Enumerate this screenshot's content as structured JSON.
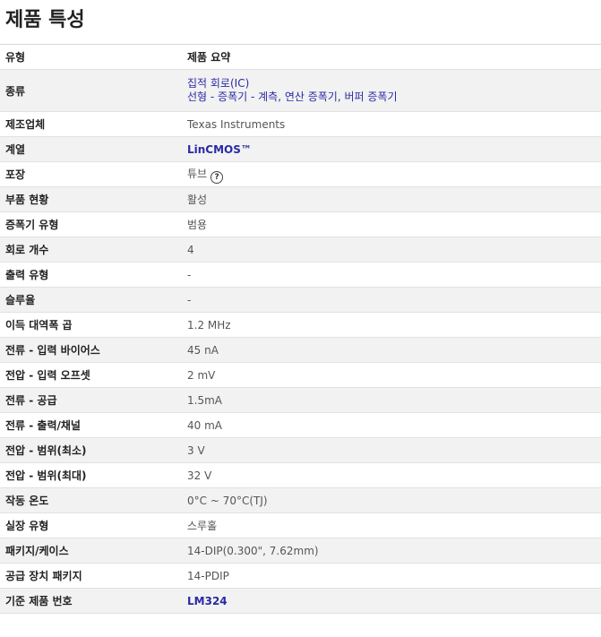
{
  "title": "제품 특성",
  "header": {
    "label": "유형",
    "value": "제품 요약"
  },
  "category": {
    "label": "종류",
    "line1": "집적 회로(IC)",
    "line2": "선형 - 증폭기 - 계측, 연산 증폭기, 버퍼 증폭기"
  },
  "rows": [
    {
      "label": "제조업체",
      "value": "Texas Instruments"
    },
    {
      "label": "계열",
      "value": "LinCMOS™"
    },
    {
      "label": "포장",
      "value": "튜브",
      "icon": "help-circle-icon"
    },
    {
      "label": "부품 현황",
      "value": "활성"
    },
    {
      "label": "증폭기 유형",
      "value": "범용"
    },
    {
      "label": "회로 개수",
      "value": "4"
    },
    {
      "label": "출력 유형",
      "value": "-"
    },
    {
      "label": "슬루율",
      "value": "-"
    },
    {
      "label": "이득 대역폭 곱",
      "value": "1.2 MHz"
    },
    {
      "label": "전류 - 입력 바이어스",
      "value": "45 nA"
    },
    {
      "label": "전압 - 입력 오프셋",
      "value": "2 mV"
    },
    {
      "label": "전류 - 공급",
      "value": "1.5mA"
    },
    {
      "label": "전류 - 출력/채널",
      "value": "40 mA"
    },
    {
      "label": "전압 - 범위(최소)",
      "value": "3 V"
    },
    {
      "label": "전압 - 범위(최대)",
      "value": "32 V"
    },
    {
      "label": "작동 온도",
      "value": "0°C ~ 70°C(TJ)"
    },
    {
      "label": "실장 유형",
      "value": "스루홀"
    },
    {
      "label": "패키지/케이스",
      "value": "14-DIP(0.300\", 7.62mm)"
    },
    {
      "label": "공급 장치 패키지",
      "value": "14-PDIP"
    },
    {
      "label": "기준 제품 번호",
      "value": "LM324"
    }
  ],
  "colors": {
    "link": "#2a2aa5",
    "stripe": "#f2f2f2"
  }
}
